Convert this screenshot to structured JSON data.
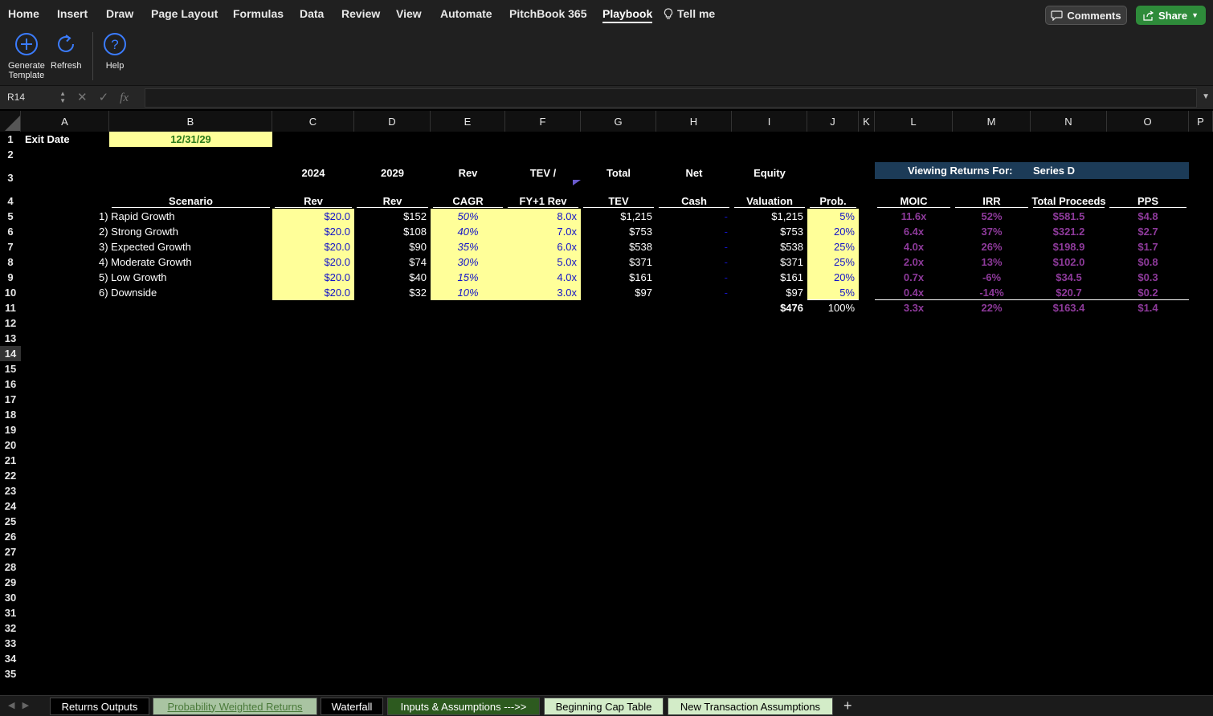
{
  "ribbon": {
    "tabs": [
      "Home",
      "Insert",
      "Draw",
      "Page Layout",
      "Formulas",
      "Data",
      "Review",
      "View",
      "Automate",
      "PitchBook 365",
      "Playbook"
    ],
    "active_tab": "Playbook",
    "tell_me": "Tell me",
    "comments": "Comments",
    "share": "Share",
    "buttons": {
      "generate_line1": "Generate",
      "generate_line2": "Template",
      "refresh": "Refresh",
      "help": "Help"
    }
  },
  "formula_bar": {
    "name_box": "R14",
    "fx": "fx",
    "value": ""
  },
  "columns": [
    "A",
    "B",
    "C",
    "D",
    "E",
    "F",
    "G",
    "H",
    "I",
    "J",
    "K",
    "L",
    "M",
    "N",
    "O",
    "P"
  ],
  "rows": [
    "1",
    "2",
    "3",
    "4",
    "5",
    "6",
    "7",
    "8",
    "9",
    "10",
    "11",
    "12",
    "13",
    "14",
    "15",
    "16",
    "17",
    "18",
    "19",
    "20",
    "21",
    "22",
    "23",
    "24",
    "25",
    "26",
    "27",
    "28",
    "29",
    "30",
    "31",
    "32",
    "33",
    "34",
    "35"
  ],
  "selected_row": "14",
  "sheet": {
    "exit_label": "Exit Date",
    "exit_date": "12/31/29",
    "hdr3": {
      "C": "2024",
      "D": "2029",
      "E": "Rev",
      "F": "TEV /",
      "G": "Total",
      "H": "Net",
      "I": "Equity"
    },
    "hdr4": {
      "B": "Scenario",
      "C": "Rev",
      "D": "Rev",
      "E": "CAGR",
      "F": "FY+1 Rev",
      "G": "TEV",
      "H": "Cash",
      "I": "Valuation",
      "J": "Prob.",
      "L": "MOIC",
      "M": "IRR",
      "N": "Total Proceeds",
      "O": "PPS"
    },
    "banner_label": "Viewing Returns For:",
    "banner_value": "Series D",
    "scenarios": [
      {
        "name": "1) Rapid Growth",
        "rev24": "$20.0",
        "rev29": "$152",
        "cagr": "50%",
        "mult": "8.0x",
        "tev": "$1,215",
        "cash": "-",
        "val": "$1,215",
        "prob": "5%",
        "moic": "11.6x",
        "irr": "52%",
        "proceeds": "$581.5",
        "pps": "$4.8"
      },
      {
        "name": "2) Strong Growth",
        "rev24": "$20.0",
        "rev29": "$108",
        "cagr": "40%",
        "mult": "7.0x",
        "tev": "$753",
        "cash": "-",
        "val": "$753",
        "prob": "20%",
        "moic": "6.4x",
        "irr": "37%",
        "proceeds": "$321.2",
        "pps": "$2.7"
      },
      {
        "name": "3) Expected Growth",
        "rev24": "$20.0",
        "rev29": "$90",
        "cagr": "35%",
        "mult": "6.0x",
        "tev": "$538",
        "cash": "-",
        "val": "$538",
        "prob": "25%",
        "moic": "4.0x",
        "irr": "26%",
        "proceeds": "$198.9",
        "pps": "$1.7"
      },
      {
        "name": "4) Moderate Growth",
        "rev24": "$20.0",
        "rev29": "$74",
        "cagr": "30%",
        "mult": "5.0x",
        "tev": "$371",
        "cash": "-",
        "val": "$371",
        "prob": "25%",
        "moic": "2.0x",
        "irr": "13%",
        "proceeds": "$102.0",
        "pps": "$0.8"
      },
      {
        "name": "5) Low Growth",
        "rev24": "$20.0",
        "rev29": "$40",
        "cagr": "15%",
        "mult": "4.0x",
        "tev": "$161",
        "cash": "-",
        "val": "$161",
        "prob": "20%",
        "moic": "0.7x",
        "irr": "-6%",
        "proceeds": "$34.5",
        "pps": "$0.3"
      },
      {
        "name": "6) Downside",
        "rev24": "$20.0",
        "rev29": "$32",
        "cagr": "10%",
        "mult": "3.0x",
        "tev": "$97",
        "cash": "-",
        "val": "$97",
        "prob": "5%",
        "moic": "0.4x",
        "irr": "-14%",
        "proceeds": "$20.7",
        "pps": "$0.2"
      }
    ],
    "totals": {
      "val": "$476",
      "prob": "100%",
      "moic": "3.3x",
      "irr": "22%",
      "proceeds": "$163.4",
      "pps": "$1.4"
    }
  },
  "sheet_tabs": [
    {
      "label": "Returns Outputs",
      "style": "black"
    },
    {
      "label": "Probability Weighted Returns",
      "style": "active"
    },
    {
      "label": "Waterfall",
      "style": "black"
    },
    {
      "label": "Inputs & Assumptions --->>",
      "style": "darkgreen"
    },
    {
      "label": "Beginning Cap Table",
      "style": "lightgreen"
    },
    {
      "label": "New Transaction Assumptions",
      "style": "lightgreen"
    }
  ],
  "colors": {
    "input_yellow": "#ffff99",
    "input_blue": "#1414c8",
    "output_purple": "#8e3a9b",
    "banner_navy": "#1c3b57",
    "share_green": "#2e8b3a"
  }
}
